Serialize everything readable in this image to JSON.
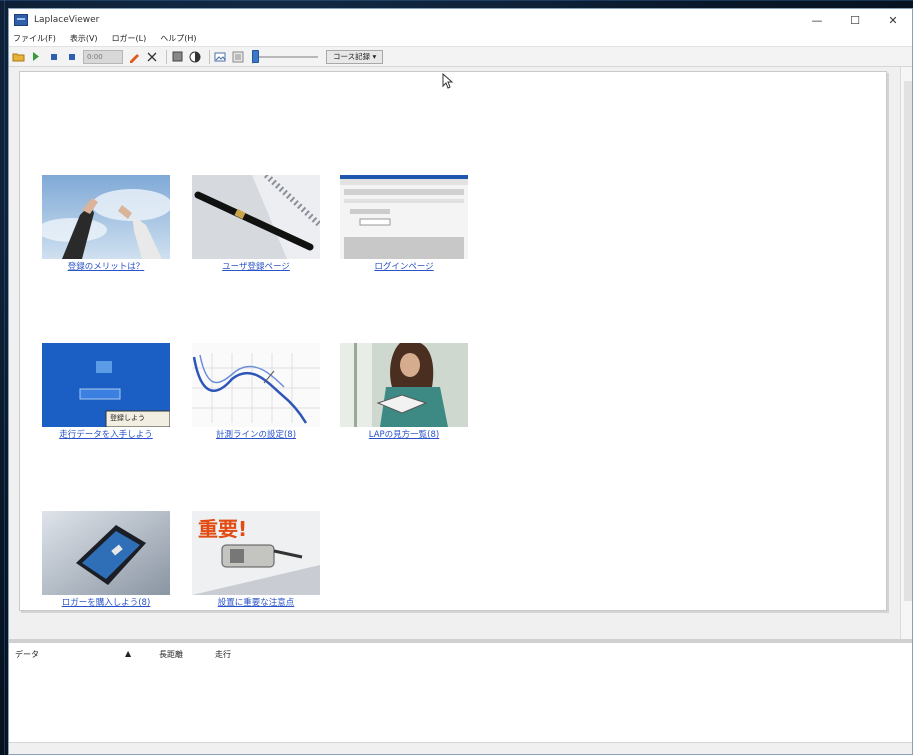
{
  "window": {
    "title": "LaplaceViewer",
    "controls": {
      "minimize": "—",
      "maximize": "☐",
      "close": "✕"
    }
  },
  "menu": [
    {
      "label": "ファイル(F)"
    },
    {
      "label": "表示(V)"
    },
    {
      "label": "ロガー(L)"
    },
    {
      "label": "ヘルプ(H)"
    }
  ],
  "toolbar": {
    "icons": [
      "open-folder-icon",
      "play-icon",
      "stop-icon",
      "record-icon",
      "pen-icon",
      "scissors-icon",
      "grid-icon",
      "contrast-icon",
      "image-icon",
      "export-icon"
    ],
    "field_value": "0:00",
    "dropdown_label": "コース記録 ▾"
  },
  "thumbnails": [
    {
      "label": "登録のメリットは？",
      "kind": "sky"
    },
    {
      "label": "ユーザ登録ページ",
      "kind": "pen"
    },
    {
      "label": "ログインページ",
      "kind": "screen"
    },
    {
      "label": "走行データを入手しよう",
      "kind": "blue"
    },
    {
      "label": "計測ラインの設定(8)",
      "kind": "chart"
    },
    {
      "label": "LAPの見方一覧(8)",
      "kind": "reader"
    },
    {
      "label": "ロガーを購入しよう(8)",
      "kind": "device"
    },
    {
      "label": "設置に重要な注意点",
      "kind": "important"
    }
  ],
  "important_text": "重要!",
  "blue_thumb_text": "登録しよう",
  "bottom": {
    "columns": [
      "データ",
      "▲",
      "長距離",
      "走行"
    ]
  },
  "colors": {
    "link": "#2a52c9",
    "accent": "#3b78c8"
  }
}
